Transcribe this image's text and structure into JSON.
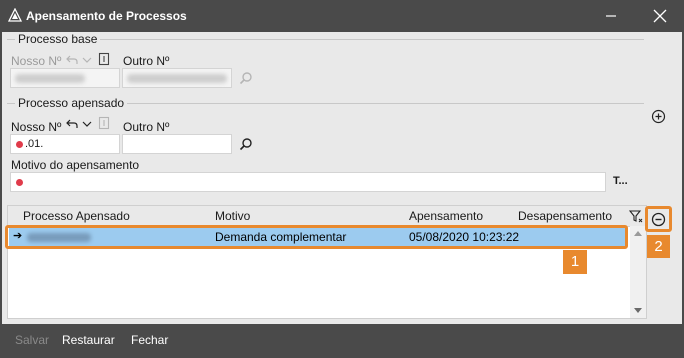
{
  "window": {
    "title": "Apensamento de Processos"
  },
  "processo_base": {
    "group_title": "Processo base",
    "nosso_label": "Nosso Nº",
    "outro_label": "Outro Nº"
  },
  "processo_apensado": {
    "group_title": "Processo apensado",
    "nosso_label": "Nosso Nº",
    "nosso_value": ".01.",
    "outro_label": "Outro Nº",
    "motivo_label": "Motivo do apensamento",
    "motivo_button": "T..."
  },
  "grid": {
    "columns": [
      "Processo Apensado",
      "Motivo",
      "Apensamento",
      "Desapensamento"
    ],
    "rows": [
      {
        "motivo": "Demanda complementar",
        "apensamento": "05/08/2020 10:23:22",
        "desapensamento": ""
      }
    ]
  },
  "annotations": {
    "badge1": "1",
    "badge2": "2",
    "color": "#e8892e"
  },
  "footer": {
    "salvar": "Salvar",
    "restaurar": "Restaurar",
    "fechar": "Fechar"
  }
}
